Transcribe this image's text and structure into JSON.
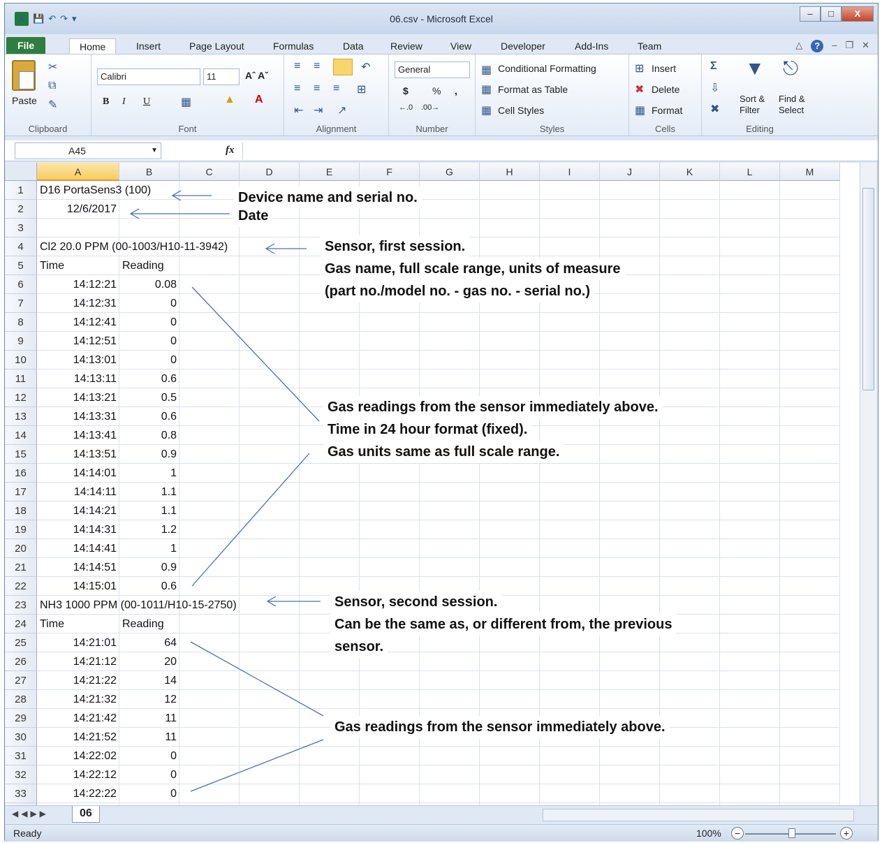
{
  "window": {
    "title": "06.csv  -  Microsoft Excel"
  },
  "tabs": [
    "File",
    "Home",
    "Insert",
    "Page Layout",
    "Formulas",
    "Data",
    "Review",
    "View",
    "Developer",
    "Add-Ins",
    "Team"
  ],
  "ribbon": {
    "clipboard": {
      "label": "Clipboard",
      "paste": "Paste"
    },
    "font": {
      "label": "Font",
      "name": "Calibri",
      "size": "11",
      "bold": "B",
      "italic": "I",
      "underline": "U"
    },
    "alignment": {
      "label": "Alignment"
    },
    "number": {
      "label": "Number",
      "format": "General",
      "currency": "$",
      "percent": "%",
      "comma": ","
    },
    "styles": {
      "label": "Styles",
      "conditional": "Conditional Formatting",
      "table": "Format as Table",
      "cell": "Cell Styles"
    },
    "cells": {
      "label": "Cells",
      "insert": "Insert",
      "delete": "Delete",
      "format": "Format"
    },
    "editing": {
      "label": "Editing",
      "sort1": "Sort &",
      "sort2": "Filter",
      "find1": "Find &",
      "find2": "Select"
    }
  },
  "formula_bar": {
    "name_box": "A45",
    "fx": "fx",
    "value": ""
  },
  "columns": [
    "A",
    "B",
    "C",
    "D",
    "E",
    "F",
    "G",
    "H",
    "I",
    "J",
    "K",
    "L",
    "M"
  ],
  "rows": [
    {
      "n": "1",
      "a": "D16 PortaSens3 (100)",
      "b": ""
    },
    {
      "n": "2",
      "a": "12/6/2017",
      "b": ""
    },
    {
      "n": "3",
      "a": "",
      "b": ""
    },
    {
      "n": "4",
      "a": "Cl2 20.0 PPM (00-1003/H10-11-3942)",
      "b": ""
    },
    {
      "n": "5",
      "a": "Time",
      "b": "Reading"
    },
    {
      "n": "6",
      "a": "14:12:21",
      "b": "0.08"
    },
    {
      "n": "7",
      "a": "14:12:31",
      "b": "0"
    },
    {
      "n": "8",
      "a": "14:12:41",
      "b": "0"
    },
    {
      "n": "9",
      "a": "14:12:51",
      "b": "0"
    },
    {
      "n": "10",
      "a": "14:13:01",
      "b": "0"
    },
    {
      "n": "11",
      "a": "14:13:11",
      "b": "0.6"
    },
    {
      "n": "12",
      "a": "14:13:21",
      "b": "0.5"
    },
    {
      "n": "13",
      "a": "14:13:31",
      "b": "0.6"
    },
    {
      "n": "14",
      "a": "14:13:41",
      "b": "0.8"
    },
    {
      "n": "15",
      "a": "14:13:51",
      "b": "0.9"
    },
    {
      "n": "16",
      "a": "14:14:01",
      "b": "1"
    },
    {
      "n": "17",
      "a": "14:14:11",
      "b": "1.1"
    },
    {
      "n": "18",
      "a": "14:14:21",
      "b": "1.1"
    },
    {
      "n": "19",
      "a": "14:14:31",
      "b": "1.2"
    },
    {
      "n": "20",
      "a": "14:14:41",
      "b": "1"
    },
    {
      "n": "21",
      "a": "14:14:51",
      "b": "0.9"
    },
    {
      "n": "22",
      "a": "14:15:01",
      "b": "0.6"
    },
    {
      "n": "23",
      "a": "NH3 1000 PPM (00-1011/H10-15-2750)",
      "b": ""
    },
    {
      "n": "24",
      "a": "Time",
      "b": "Reading"
    },
    {
      "n": "25",
      "a": "14:21:01",
      "b": "64"
    },
    {
      "n": "26",
      "a": "14:21:12",
      "b": "20"
    },
    {
      "n": "27",
      "a": "14:21:22",
      "b": "14"
    },
    {
      "n": "28",
      "a": "14:21:32",
      "b": "12"
    },
    {
      "n": "29",
      "a": "14:21:42",
      "b": "11"
    },
    {
      "n": "30",
      "a": "14:21:52",
      "b": "11"
    },
    {
      "n": "31",
      "a": "14:22:02",
      "b": "0"
    },
    {
      "n": "32",
      "a": "14:22:12",
      "b": "0"
    },
    {
      "n": "33",
      "a": "14:22:22",
      "b": "0"
    }
  ],
  "annotations": {
    "device": "Device name and serial no.",
    "date": "Date",
    "sensor1_l1": "Sensor, first session.",
    "sensor1_l2": "Gas name, full scale range,  units of measure",
    "sensor1_l3": "(part no./model no. - gas no. - serial no.)",
    "readings1_l1": "Gas readings from the sensor immediately above.",
    "readings1_l2": "Time in 24 hour format (fixed).",
    "readings1_l3": "Gas units same as full scale range.",
    "sensor2_l1": "Sensor, second session.",
    "sensor2_l2": "Can be the same as, or different from, the previous",
    "sensor2_l3": "sensor.",
    "readings2_l1": "Gas readings from the sensor immediately above."
  },
  "sheet_tab": "06",
  "status": {
    "ready": "Ready",
    "zoom": "100%"
  }
}
